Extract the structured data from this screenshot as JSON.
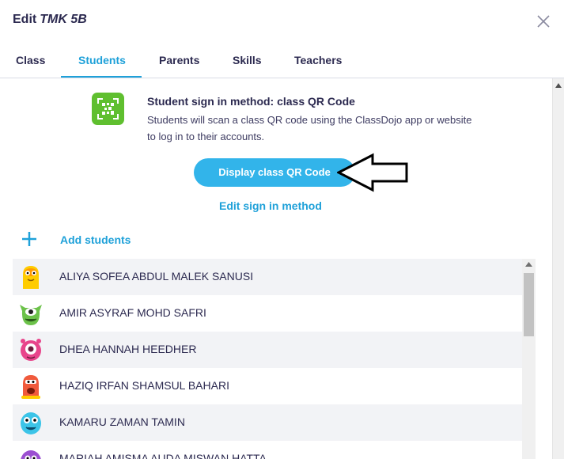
{
  "header": {
    "title_prefix": "Edit",
    "class_name": "TMK 5B"
  },
  "tabs": [
    {
      "label": "Class",
      "active": false
    },
    {
      "label": "Students",
      "active": true
    },
    {
      "label": "Parents",
      "active": false
    },
    {
      "label": "Skills",
      "active": false
    },
    {
      "label": "Teachers",
      "active": false
    }
  ],
  "signin": {
    "title": "Student sign in method: class QR Code",
    "description": "Students will scan a class QR code using the ClassDojo app or website to log in to their accounts.",
    "qr_button_label": "Display class QR Code",
    "edit_link_label": "Edit sign in method",
    "icon": "qr-code-icon"
  },
  "add_students": {
    "label": "Add students",
    "icon": "plus-icon"
  },
  "students": [
    {
      "name": "ALIYA SOFEA ABDUL MALEK SANUSI",
      "avatar_color": "#ffcc00"
    },
    {
      "name": "AMIR ASYRAF MOHD SAFRI",
      "avatar_color": "#6cc24a"
    },
    {
      "name": "DHEA HANNAH HEEDHER",
      "avatar_color": "#e8458b"
    },
    {
      "name": "HAZIQ IRFAN SHAMSUL BAHARI",
      "avatar_color": "#f05a3c"
    },
    {
      "name": "KAMARU ZAMAN TAMIN",
      "avatar_color": "#3cc4e8"
    },
    {
      "name": "MARIAH AMISMA AUDA MISWAN HATTA",
      "avatar_color": "#9b4fd1"
    }
  ],
  "colors": {
    "accent": "#1fa1d9",
    "button": "#32b4ea",
    "qr_icon_bg": "#5fbf2f",
    "text": "#2c2a50"
  }
}
